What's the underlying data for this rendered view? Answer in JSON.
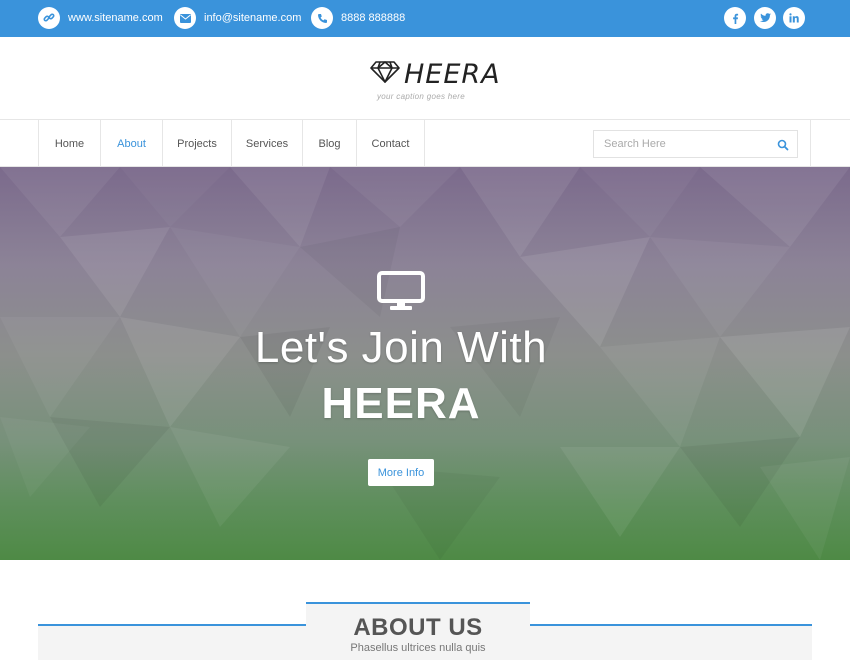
{
  "topbar": {
    "website": {
      "icon": "link-icon",
      "text": "www.sitename.com"
    },
    "email": {
      "icon": "envelope-icon",
      "text": "info@sitename.com"
    },
    "phone": {
      "icon": "phone-icon",
      "text": "8888 888888"
    },
    "social": [
      {
        "icon": "facebook-icon",
        "glyph": "f"
      },
      {
        "icon": "twitter-icon",
        "glyph": "t"
      },
      {
        "icon": "linkedin-icon",
        "glyph": "in"
      }
    ]
  },
  "brand": {
    "logo_icon": "diamond-icon",
    "name": "HEERA",
    "tagline": "your caption goes here"
  },
  "nav": {
    "items": [
      {
        "label": "Home",
        "active": false
      },
      {
        "label": "About",
        "active": true
      },
      {
        "label": "Projects",
        "active": false
      },
      {
        "label": "Services",
        "active": false
      },
      {
        "label": "Blog",
        "active": false
      },
      {
        "label": "Contact",
        "active": false
      }
    ],
    "search_placeholder": "Search Here",
    "search_icon": "search-icon"
  },
  "hero": {
    "icon": "monitor-icon",
    "line1": "Let's Join With",
    "line2": "HEERA",
    "button": "More Info"
  },
  "about": {
    "title": "ABOUT US",
    "subtitle": "Phasellus ultrices nulla quis"
  },
  "colors": {
    "accent": "#3a93db",
    "text": "#555555"
  }
}
